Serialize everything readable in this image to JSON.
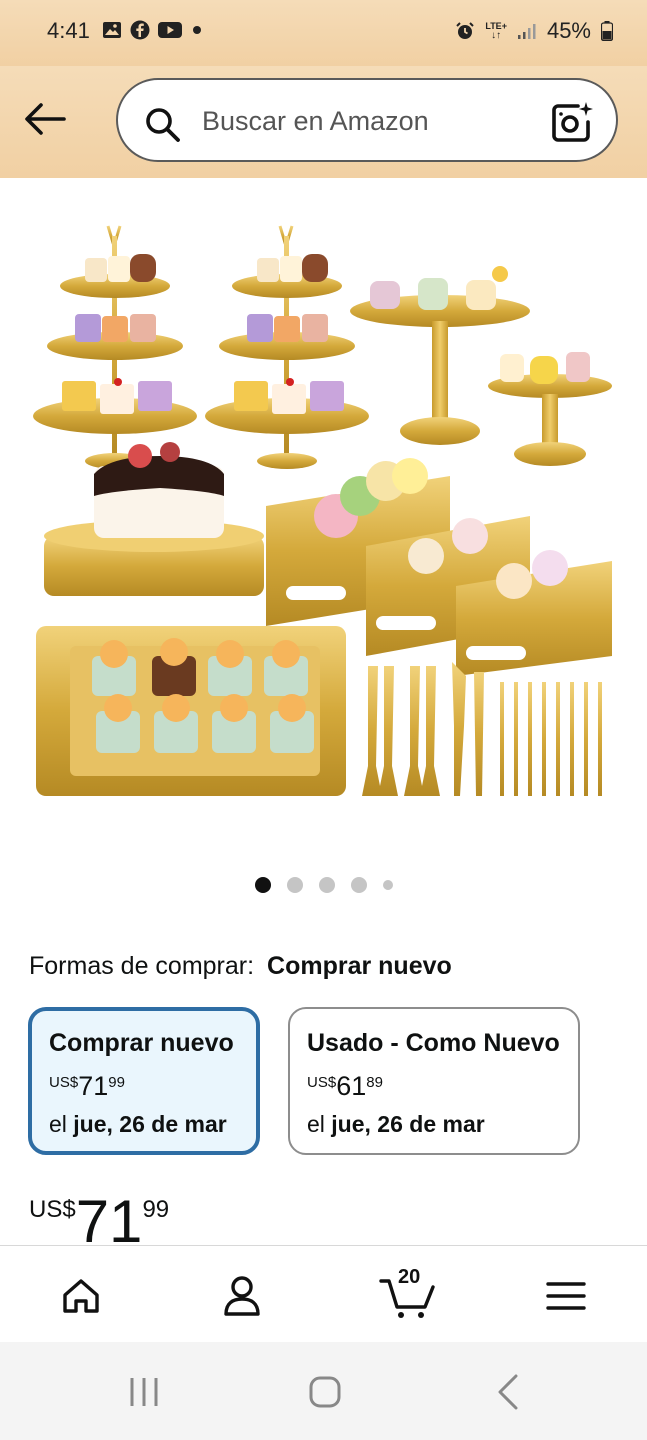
{
  "status_bar": {
    "time": "4:41",
    "network": "LTE+",
    "battery": "45%",
    "left_icons": [
      "gallery-icon",
      "facebook-icon",
      "youtube-icon",
      "dot-icon"
    ],
    "right_icons": [
      "alarm-icon",
      "lte-icon",
      "signal-icon",
      "battery-icon"
    ]
  },
  "header": {
    "search_placeholder": "Buscar en Amazon",
    "icons": [
      "back-arrow-icon",
      "search-icon",
      "camera-search-icon"
    ]
  },
  "carousel": {
    "total_dots": 5,
    "active_index": 0
  },
  "buy_options": {
    "label": "Formas de comprar:",
    "selected": "Comprar nuevo",
    "offers": [
      {
        "title": "Comprar nuevo",
        "currency": "US$",
        "price_whole": "71",
        "price_fraction": "99",
        "date_prefix": "el",
        "date": "jue, 26 de mar",
        "selected": true
      },
      {
        "title": "Usado - Como Nuevo",
        "currency": "US$",
        "price_whole": "61",
        "price_fraction": "89",
        "date_prefix": "el",
        "date": "jue, 26 de mar",
        "selected": false
      }
    ]
  },
  "price": {
    "currency": "US$",
    "whole": "71",
    "fraction": "99"
  },
  "bottom_nav": {
    "cart_count": "20",
    "icons": [
      "home-icon",
      "account-icon",
      "cart-icon",
      "menu-icon"
    ]
  },
  "system_nav": {
    "icons": [
      "recents-icon",
      "home-button-icon",
      "back-icon"
    ]
  },
  "colors": {
    "header_bg": "#f3d6ae",
    "selected_border": "#2e6da4",
    "selected_bg": "#eaf6fd",
    "gold": "#d4a93b"
  }
}
